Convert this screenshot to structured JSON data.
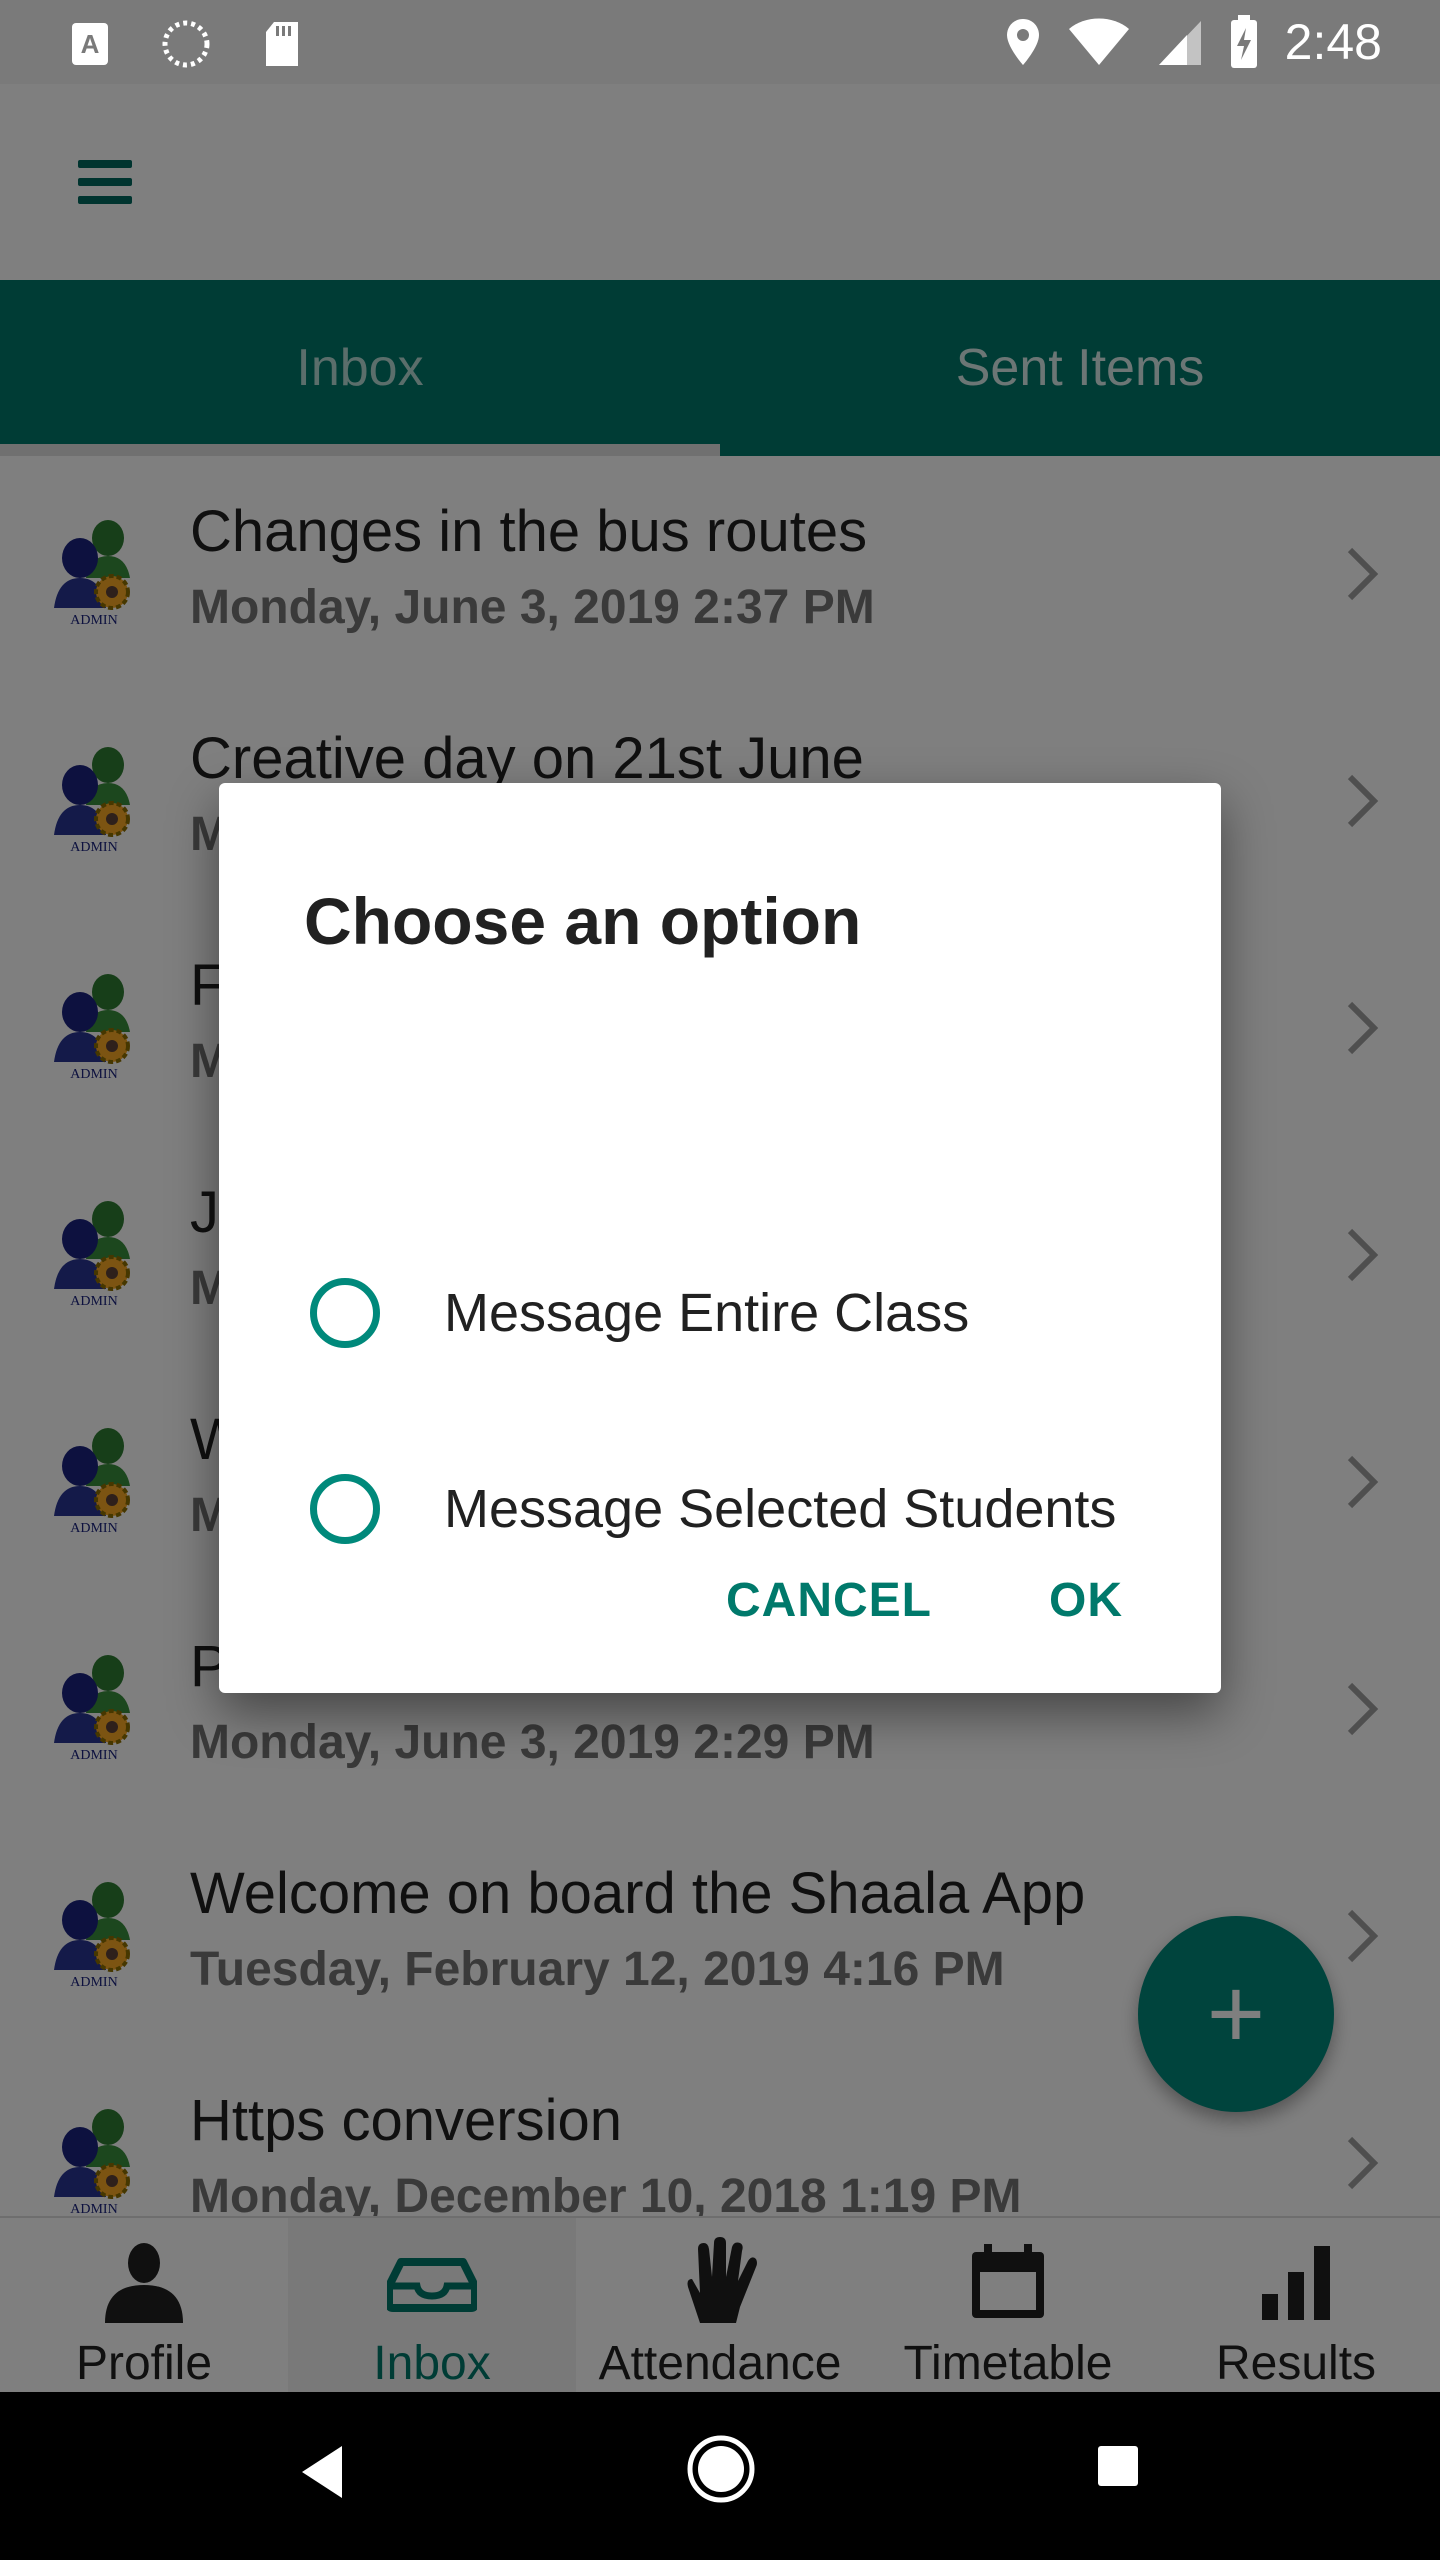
{
  "status_bar": {
    "time": "2:48",
    "left_icons": [
      "text-a-icon",
      "sync-icon",
      "sd-card-icon"
    ],
    "right_icons": [
      "location-icon",
      "wifi-icon",
      "signal-icon",
      "battery-charging-icon"
    ]
  },
  "app_bar": {
    "menu_icon": "hamburger-menu-icon"
  },
  "tabs": [
    {
      "label": "Inbox",
      "active": true
    },
    {
      "label": "Sent Items",
      "active": false
    }
  ],
  "messages": [
    {
      "title": "Changes in the bus routes",
      "date": "Monday, June 3, 2019 2:37 PM",
      "avatar_label": "ADMIN"
    },
    {
      "title": "Creative day on 21st June",
      "date": "M",
      "avatar_label": "ADMIN"
    },
    {
      "title": "F",
      "date": "M",
      "avatar_label": "ADMIN"
    },
    {
      "title": "J",
      "date": "M",
      "avatar_label": "ADMIN"
    },
    {
      "title": "W",
      "date": "M",
      "avatar_label": "ADMIN"
    },
    {
      "title": "P",
      "date": "Monday, June 3, 2019 2:29 PM",
      "avatar_label": "ADMIN"
    },
    {
      "title": "Welcome on board the Shaala App",
      "date": "Tuesday, February 12, 2019 4:16 PM",
      "avatar_label": "ADMIN"
    },
    {
      "title": "Https conversion",
      "date": "Monday, December 10, 2018 1:19 PM",
      "avatar_label": "ADMIN"
    }
  ],
  "fab": {
    "label": "+"
  },
  "bottom_nav": [
    {
      "label": "Profile",
      "icon": "person-icon",
      "active": false
    },
    {
      "label": "Inbox",
      "icon": "inbox-tray-icon",
      "active": true
    },
    {
      "label": "Attendance",
      "icon": "hand-icon",
      "active": false
    },
    {
      "label": "Timetable",
      "icon": "calendar-icon",
      "active": false
    },
    {
      "label": "Results",
      "icon": "bar-chart-icon",
      "active": false
    }
  ],
  "dialog": {
    "title": "Choose an option",
    "options": [
      "Message Entire Class",
      "Message Selected Students"
    ],
    "cancel_label": "CANCEL",
    "ok_label": "OK"
  },
  "colors": {
    "primary": "#00796b",
    "accent": "#00897b",
    "scrim": "rgba(0,0,0,0.5)"
  }
}
